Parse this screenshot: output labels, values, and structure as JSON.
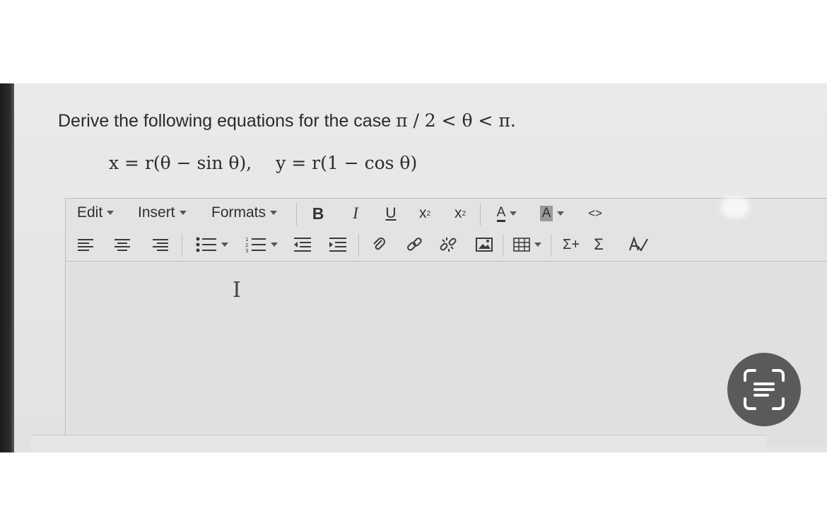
{
  "question": {
    "text": "Derive the following equations for the case ",
    "condition": "π / 2 < θ < π."
  },
  "equation": {
    "x": "x = r(θ − sin θ),",
    "y": "y = r(1 − cos θ)"
  },
  "menubar": {
    "edit": "Edit",
    "insert": "Insert",
    "formats": "Formats"
  },
  "toolbar": {
    "bold": "B",
    "italic": "I",
    "underline": "U",
    "subscript": "x",
    "superscript": "x",
    "font_color": "A",
    "bg_color": "A",
    "code": "<>",
    "sigma_plus": "Σ+",
    "sigma": "Σ"
  }
}
